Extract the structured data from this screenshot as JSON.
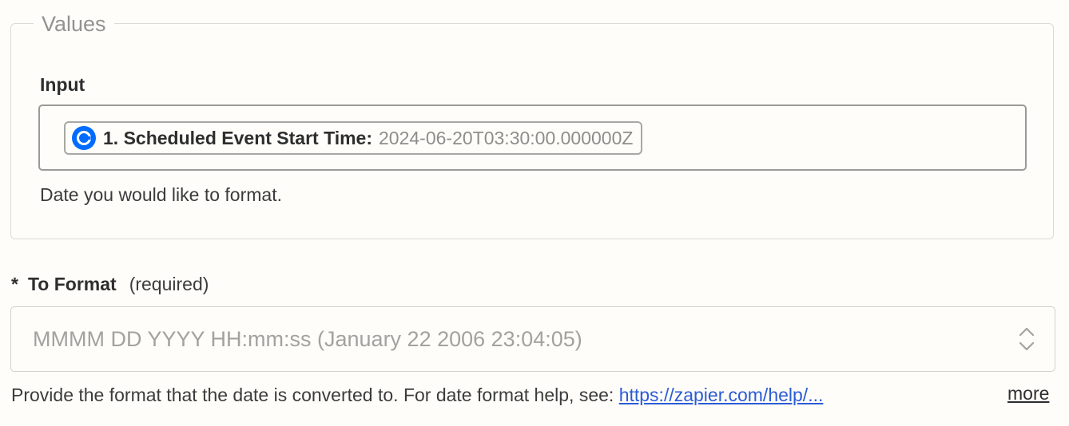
{
  "values_section": {
    "legend": "Values",
    "input": {
      "label": "Input",
      "pill": {
        "icon": "calendly-icon",
        "label": "1. Scheduled Event Start Time:",
        "value": "2024-06-20T03:30:00.000000Z"
      },
      "help_text": "Date you would like to format."
    }
  },
  "to_format": {
    "required_marker": "*",
    "label": "To Format",
    "required_note": "(required)",
    "selected_value": "MMMM DD YYYY HH:mm:ss (January 22 2006 23:04:05)",
    "help_text": "Provide the format that the date is converted to. For date format help, see: ",
    "help_link": "https://zapier.com/help/...",
    "more_label": "more"
  },
  "colors": {
    "accent_link": "#2b5bd7",
    "calendly_blue": "#006bff"
  }
}
